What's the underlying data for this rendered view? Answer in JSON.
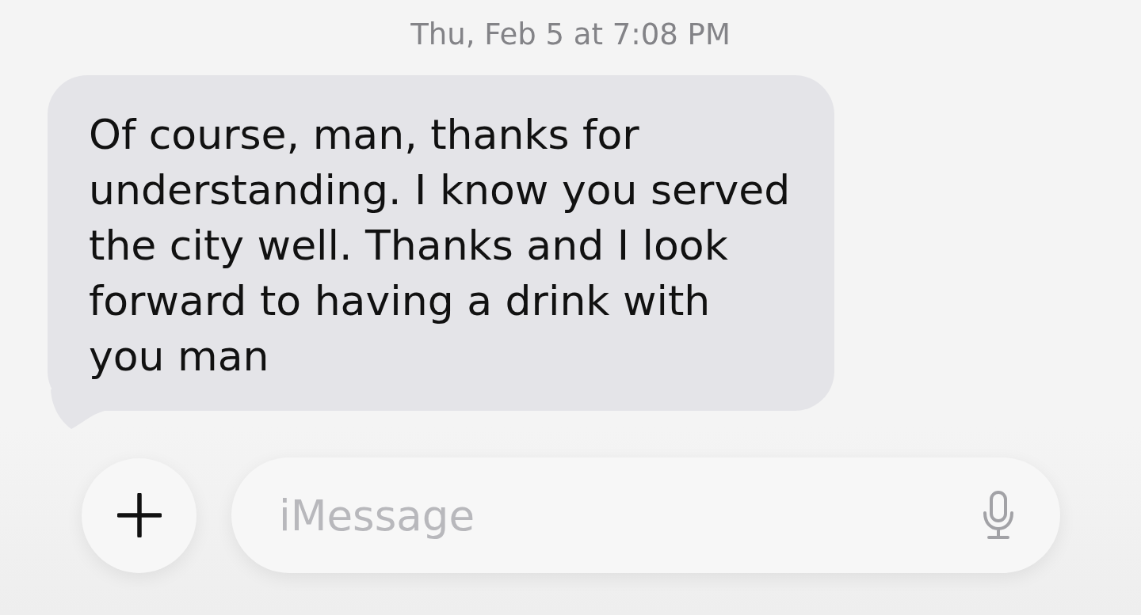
{
  "conversation": {
    "timestamp": "Thu, Feb 5 at 7:08 PM",
    "messages": [
      {
        "kind": "incoming",
        "text": "Of course, man, thanks for understanding. I know you served the city well. Thanks and I look forward to having a drink with you man"
      }
    ]
  },
  "composer": {
    "placeholder": "iMessage"
  }
}
